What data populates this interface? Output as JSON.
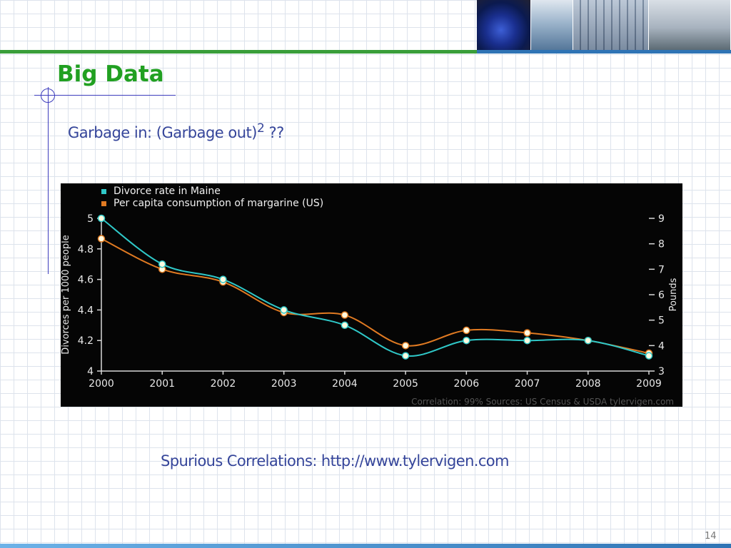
{
  "slide": {
    "title": "Big Data",
    "subtitle_text": "Garbage in: (Garbage out)",
    "subtitle_sup": "2",
    "subtitle_suffix": " ??",
    "caption": "Spurious Correlations: http://www.tylervigen.com",
    "page_number": "14"
  },
  "colors": {
    "title_green": "#21a021",
    "text_blue": "#35459a",
    "rule_blue": "#3d3dbd",
    "series_divorce": "#2fc8c8",
    "series_margarine": "#e07a22"
  },
  "chart_data": {
    "type": "line",
    "x": [
      "2000",
      "2001",
      "2002",
      "2003",
      "2004",
      "2005",
      "2006",
      "2007",
      "2008",
      "2009"
    ],
    "series": [
      {
        "name": "Divorce rate in Maine",
        "axis": "left",
        "color": "#2fc8c8",
        "values": [
          5.0,
          4.7,
          4.6,
          4.4,
          4.3,
          4.1,
          4.2,
          4.2,
          4.2,
          4.1
        ]
      },
      {
        "name": "Per capita consumption of margarine (US)",
        "axis": "right",
        "color": "#e07a22",
        "values": [
          8.2,
          7.0,
          6.5,
          5.3,
          5.2,
          4.0,
          4.6,
          4.5,
          4.2,
          3.7
        ]
      }
    ],
    "ylabel": "Divorces per 1000 people",
    "y2label": "Pounds",
    "ylim": [
      4,
      5
    ],
    "y2lim": [
      3,
      9
    ],
    "yticks": [
      "4",
      "4.2",
      "4.4",
      "4.6",
      "4.8",
      "5"
    ],
    "y2ticks": [
      "3",
      "4",
      "5",
      "6",
      "7",
      "8",
      "9"
    ],
    "legend_position": "top-left",
    "footer": "Correlation: 99%    Sources: US Census & USDA    tylervigen.com"
  }
}
